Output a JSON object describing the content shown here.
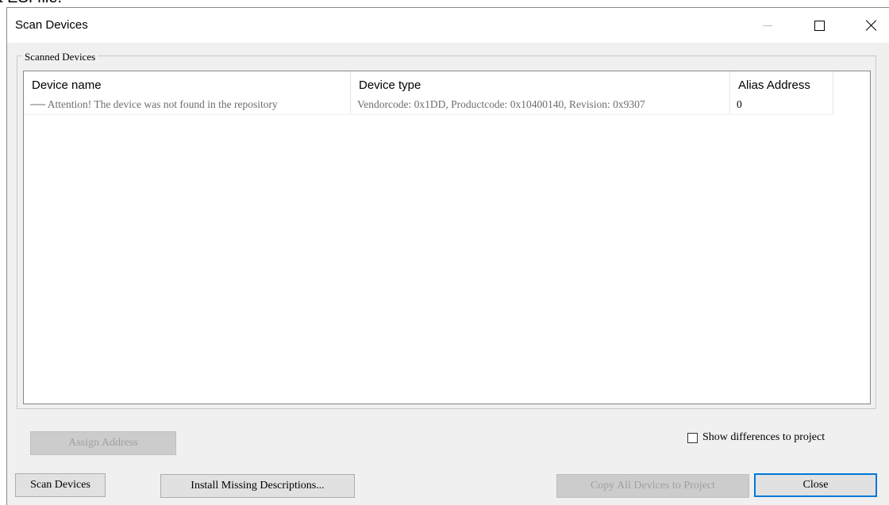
{
  "background_fragment": "t ESI file.",
  "window": {
    "title": "Scan Devices",
    "controls": {
      "minimize_icon": "minimize-icon",
      "maximize_icon": "maximize-icon",
      "close_icon": "close-icon"
    }
  },
  "group": {
    "label": "Scanned Devices"
  },
  "table": {
    "columns": [
      "Device name",
      "Device type",
      "Alias Address"
    ],
    "rows": [
      {
        "device_name": "── Attention! The device was not found in the repository",
        "device_type": "Vendorcode: 0x1DD, Productcode: 0x10400140, Revision: 0x9307",
        "alias_address": "0"
      }
    ]
  },
  "buttons": {
    "assign_address": "Assign Address",
    "scan_devices": "Scan Devices",
    "install_missing": "Install Missing Descriptions...",
    "copy_all": "Copy All Devices to Project",
    "close": "Close"
  },
  "checkbox": {
    "label": "Show differences to project",
    "checked": false
  },
  "colors": {
    "accent": "#0078d7",
    "dialog_bg": "#f0f0f0",
    "disabled_text": "#a0a0a0"
  }
}
